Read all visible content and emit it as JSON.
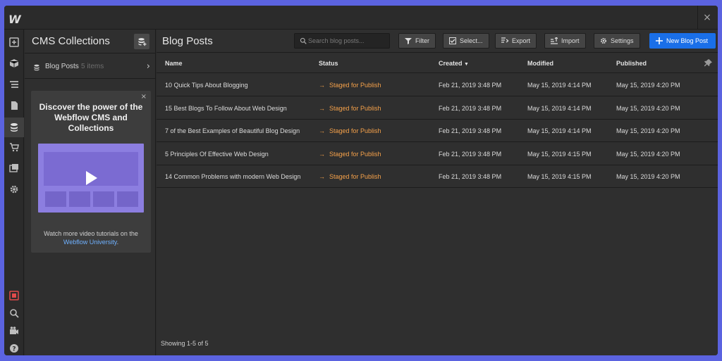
{
  "app": {
    "logo": "W",
    "close": "×"
  },
  "collections": {
    "title": "CMS Collections",
    "items": [
      {
        "name": "Blog Posts",
        "count": "5 items"
      }
    ]
  },
  "promo": {
    "close": "×",
    "heading": "Discover the power of the Webflow CMS and Collections",
    "footer_text": "Watch more video tutorials on the",
    "footer_link": "Webflow University",
    "footer_end": "."
  },
  "main": {
    "title": "Blog Posts",
    "search_placeholder": "Search blog posts...",
    "buttons": {
      "filter": "Filter",
      "select": "Select...",
      "export": "Export",
      "import": "Import",
      "settings": "Settings",
      "new": "New Blog Post"
    },
    "columns": {
      "name": "Name",
      "status": "Status",
      "created": "Created",
      "modified": "Modified",
      "published": "Published"
    },
    "rows": [
      {
        "name": "10 Quick Tips About Blogging",
        "status": "Staged for Publish",
        "created": "Feb 21, 2019 3:48 PM",
        "modified": "May 15, 2019 4:14 PM",
        "published": "May 15, 2019 4:20 PM"
      },
      {
        "name": "15 Best Blogs To Follow About Web Design",
        "status": "Staged for Publish",
        "created": "Feb 21, 2019 3:48 PM",
        "modified": "May 15, 2019 4:14 PM",
        "published": "May 15, 2019 4:20 PM"
      },
      {
        "name": "7 of the Best Examples of Beautiful Blog Design",
        "status": "Staged for Publish",
        "created": "Feb 21, 2019 3:48 PM",
        "modified": "May 15, 2019 4:14 PM",
        "published": "May 15, 2019 4:20 PM"
      },
      {
        "name": "5 Principles Of Effective Web Design",
        "status": "Staged for Publish",
        "created": "Feb 21, 2019 3:48 PM",
        "modified": "May 15, 2019 4:15 PM",
        "published": "May 15, 2019 4:20 PM"
      },
      {
        "name": "14 Common Problems with modern Web Design",
        "status": "Staged for Publish",
        "created": "Feb 21, 2019 3:48 PM",
        "modified": "May 15, 2019 4:15 PM",
        "published": "May 15, 2019 4:20 PM"
      }
    ],
    "showing": "Showing 1-5 of 5"
  },
  "colors": {
    "accent": "#1a6fe8",
    "status": "#f5a14a",
    "background": "#5b63e0"
  }
}
